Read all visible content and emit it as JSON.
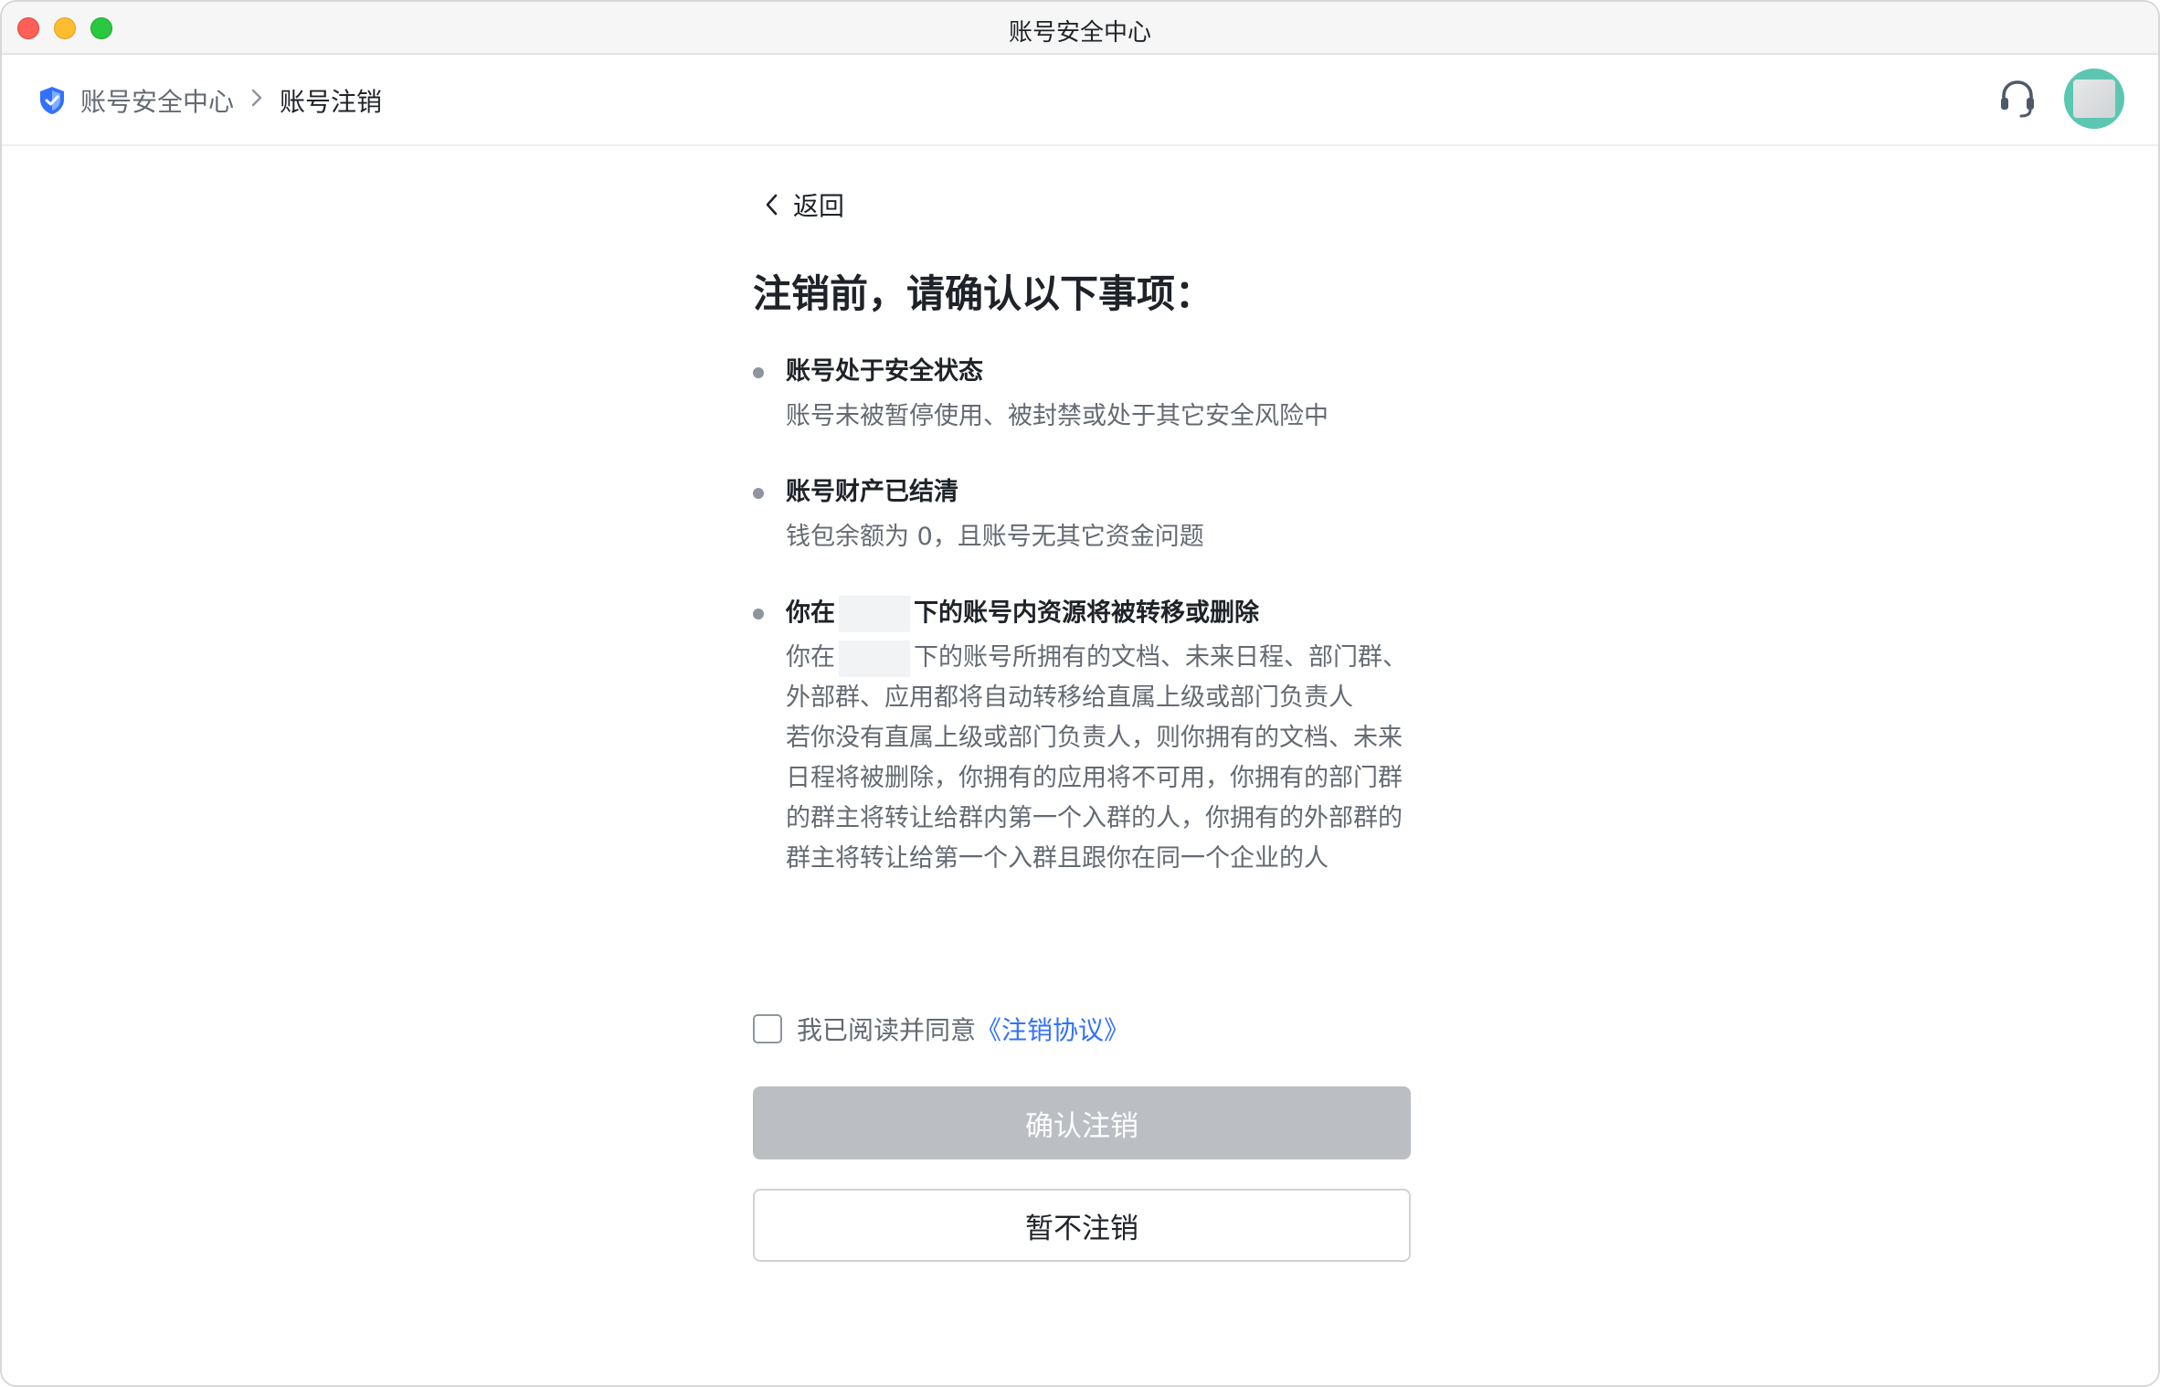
{
  "window": {
    "title": "账号安全中心"
  },
  "breadcrumb": {
    "parent": "账号安全中心",
    "current": "账号注销"
  },
  "header": {
    "icons": [
      "shield-icon",
      "headset-icon",
      "avatar"
    ]
  },
  "main": {
    "back_label": "返回",
    "title": "注销前，请确认以下事项：",
    "items": [
      {
        "title": "账号处于安全状态",
        "desc": "账号未被暂停使用、被封禁或处于其它安全风险中"
      },
      {
        "title": "账号财产已结清",
        "desc": "钱包余额为 0，且账号无其它资金问题"
      },
      {
        "title_prefix": "你在",
        "title_suffix": "下的账号内资源将被转移或删除",
        "desc1_prefix": "你在",
        "desc1_suffix": "下的账号所拥有的文档、未来日程、部门群、外部群、应用都将自动转移给直属上级或部门负责人",
        "desc2": "若你没有直属上级或部门负责人，则你拥有的文档、未来日程将被删除，你拥有的应用将不可用，你拥有的部门群的群主将转让给群内第一个入群的人，你拥有的外部群的群主将转让给第一个入群且跟你在同一个企业的人"
      }
    ],
    "agree_text": "我已阅读并同意",
    "agree_link": "《注销协议》",
    "agree_checked": false,
    "confirm_label": "确认注销",
    "cancel_label": "暂不注销"
  },
  "colors": {
    "link": "#3370ff",
    "disabled_button": "#bbbfc4",
    "avatar": "#5cc6b2",
    "shield": "#3370ff"
  }
}
